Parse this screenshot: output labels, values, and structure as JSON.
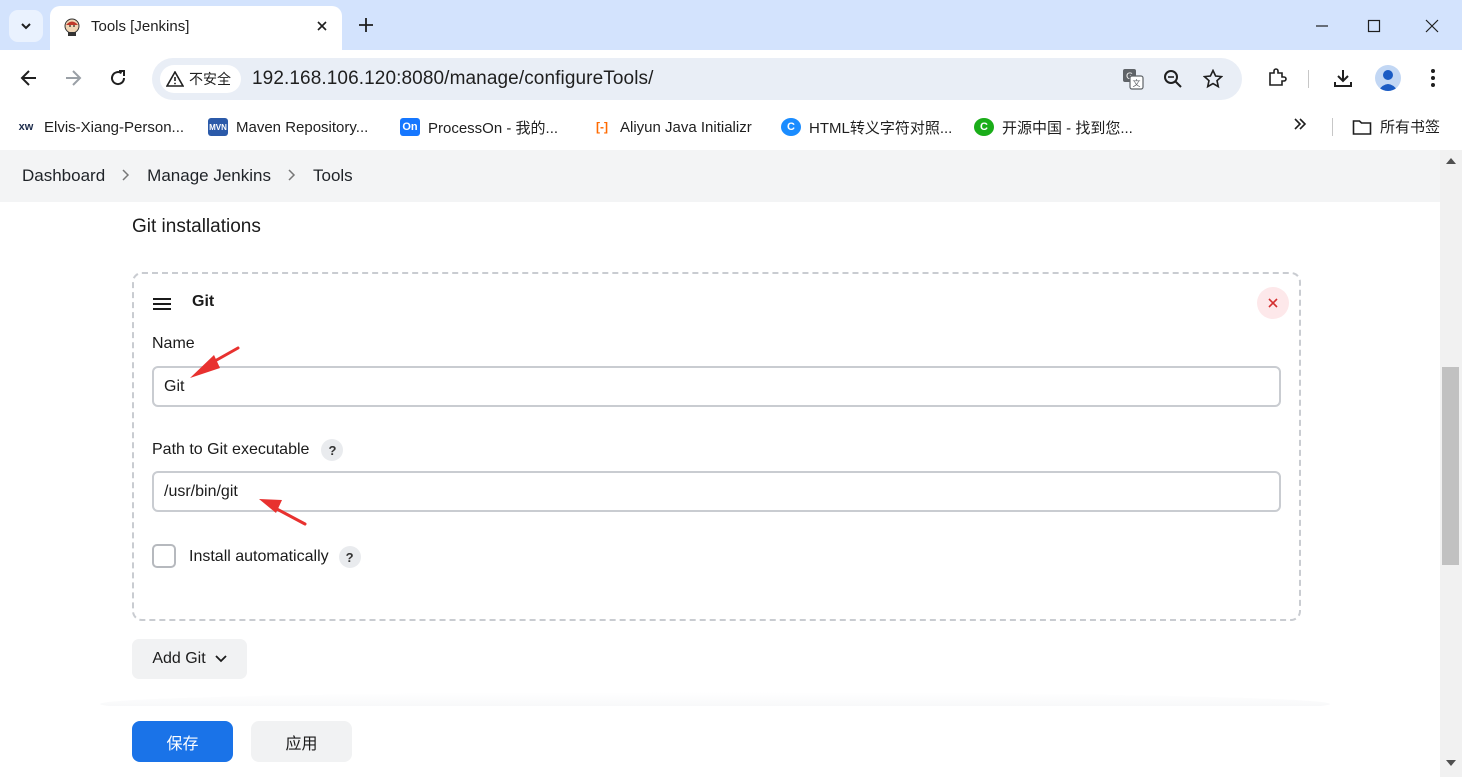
{
  "browser": {
    "tab": {
      "title": "Tools [Jenkins]"
    },
    "security_label": "不安全",
    "url": "192.168.106.120:8080/manage/configureTools/",
    "bookmarks": [
      {
        "icon_text": "xw",
        "label": "Elvis-Xiang-Person...",
        "color": "#1b2a4a"
      },
      {
        "icon_text": "MVN",
        "label": "Maven Repository...",
        "color": "#2b5aa9"
      },
      {
        "icon_text": "On",
        "label": "ProcessOn - 我的...",
        "color": "#1677ff"
      },
      {
        "icon_text": "[-]",
        "label": "Aliyun Java Initializr",
        "color": "#ff6a00"
      },
      {
        "icon_text": "C",
        "label": "HTML转义字符对照...",
        "color": "#1a8cff"
      },
      {
        "icon_text": "C",
        "label": "开源中国 - 找到您...",
        "color": "#1aad19"
      }
    ],
    "all_bookmarks_label": "所有书签"
  },
  "breadcrumb": {
    "items": [
      "Dashboard",
      "Manage Jenkins",
      "Tools"
    ]
  },
  "section": {
    "title": "Git installations",
    "card": {
      "title": "Git",
      "name_label": "Name",
      "name_value": "Git",
      "path_label": "Path to Git executable",
      "path_value": "/usr/bin/git",
      "help_glyph": "?",
      "install_auto_label": "Install automatically",
      "install_auto_checked": false
    },
    "add_button_label": "Add Git"
  },
  "actions": {
    "save_label": "保存",
    "apply_label": "应用"
  },
  "colors": {
    "accent": "#1a73e8",
    "annotation_arrow": "#e8312f",
    "tabstrip": "#d3e3fd"
  }
}
